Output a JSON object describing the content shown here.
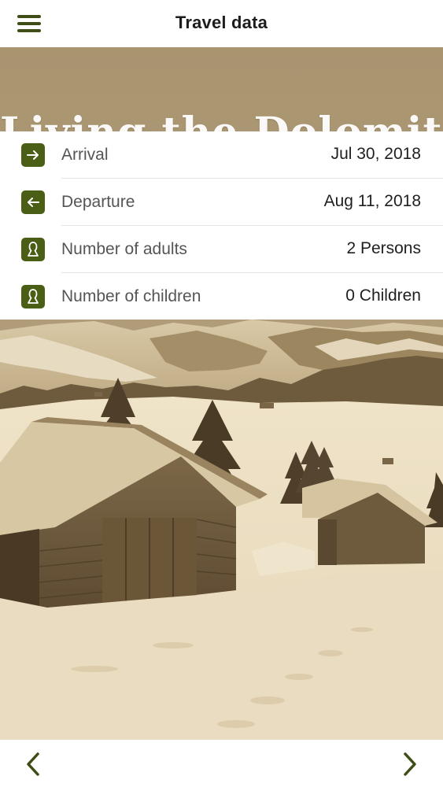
{
  "header": {
    "title": "Travel data",
    "menu_icon": "hamburger-menu-icon"
  },
  "hero": {
    "heading": "Living the Dolomites"
  },
  "travel_data": {
    "rows": [
      {
        "icon": "arrow-right-icon",
        "label": "Arrival",
        "value": "Jul 30, 2018"
      },
      {
        "icon": "arrow-left-icon",
        "label": "Departure",
        "value": "Aug 11, 2018"
      },
      {
        "icon": "person-icon",
        "label": "Number of adults",
        "value": "2 Persons"
      },
      {
        "icon": "person-icon",
        "label": "Number of children",
        "value": "0 Children"
      }
    ]
  },
  "footer": {
    "prev_icon": "chevron-left-icon",
    "next_icon": "chevron-right-icon"
  },
  "colors": {
    "accent": "#4b5e16",
    "sepia_sky": "#b29f7e",
    "snow": "#efe4cc"
  }
}
